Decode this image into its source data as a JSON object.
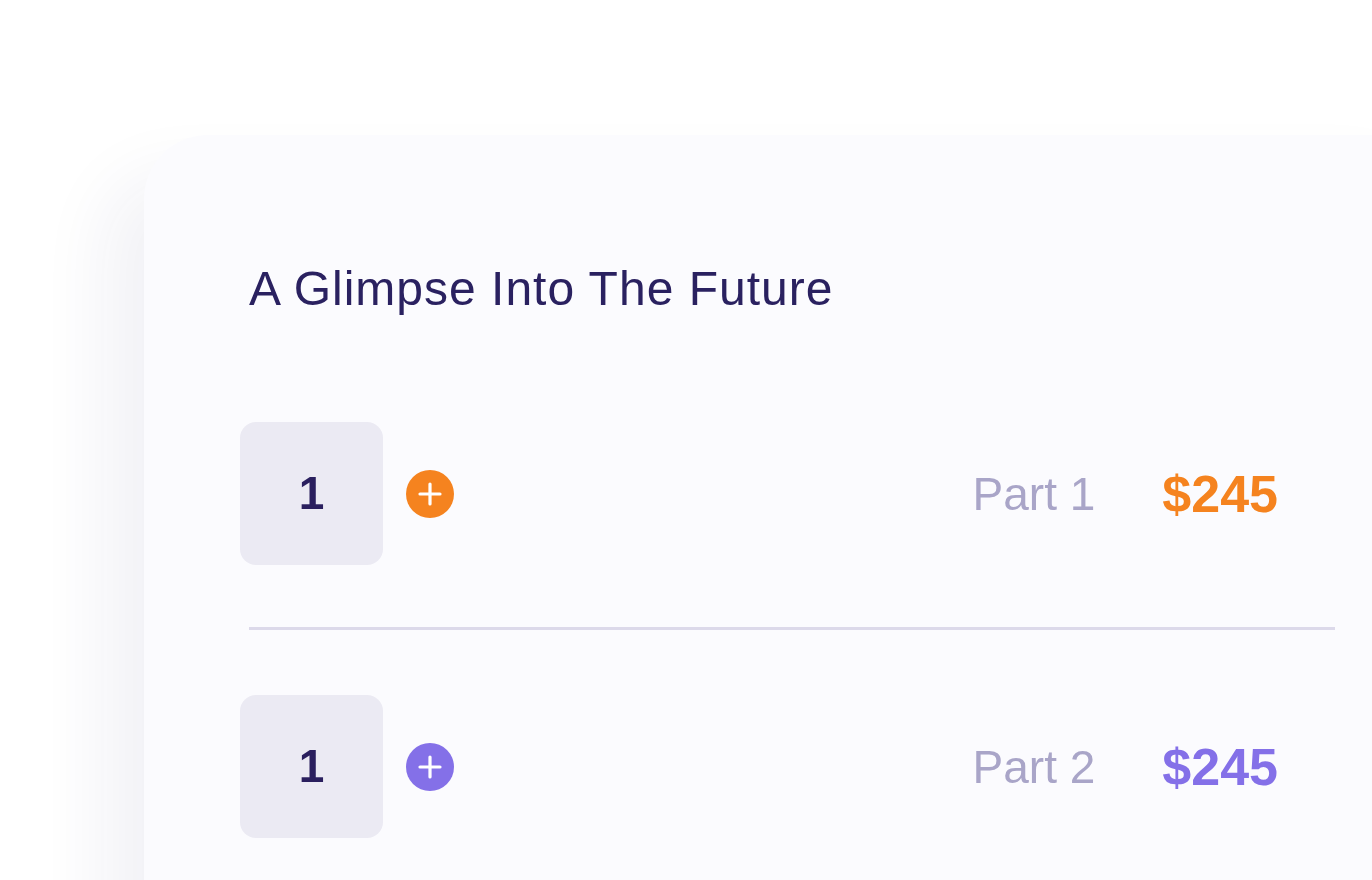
{
  "card": {
    "title": "A Glimpse Into The Future",
    "items": [
      {
        "quantity": "1",
        "label": "Part 1",
        "price": "$245",
        "color": "#f5831f"
      },
      {
        "quantity": "1",
        "label": "Part 2",
        "price": "$245",
        "color": "#8470e8"
      }
    ]
  }
}
